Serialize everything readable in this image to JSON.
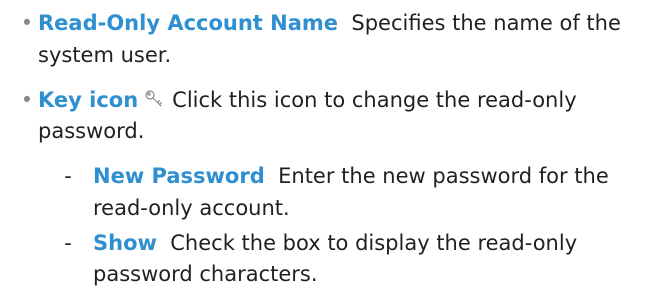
{
  "items": [
    {
      "term": "Read-Only Account Name",
      "desc_1": "Specifies the name of the",
      "desc_2": "system user."
    },
    {
      "term": "Key icon",
      "icon": "key-icon",
      "desc_1": "Click this icon to change the read-only",
      "desc_2": "password."
    }
  ],
  "sub_items": [
    {
      "term": "New Password",
      "desc_1": "Enter the new password for the",
      "desc_2": "read-only account."
    },
    {
      "term": "Show",
      "desc_1": "Check the box to display the read-only",
      "desc_2": "password characters."
    }
  ],
  "colors": {
    "term": "#2e8fd1",
    "body_text": "#231f20",
    "bullet": "#8a8a8a"
  }
}
